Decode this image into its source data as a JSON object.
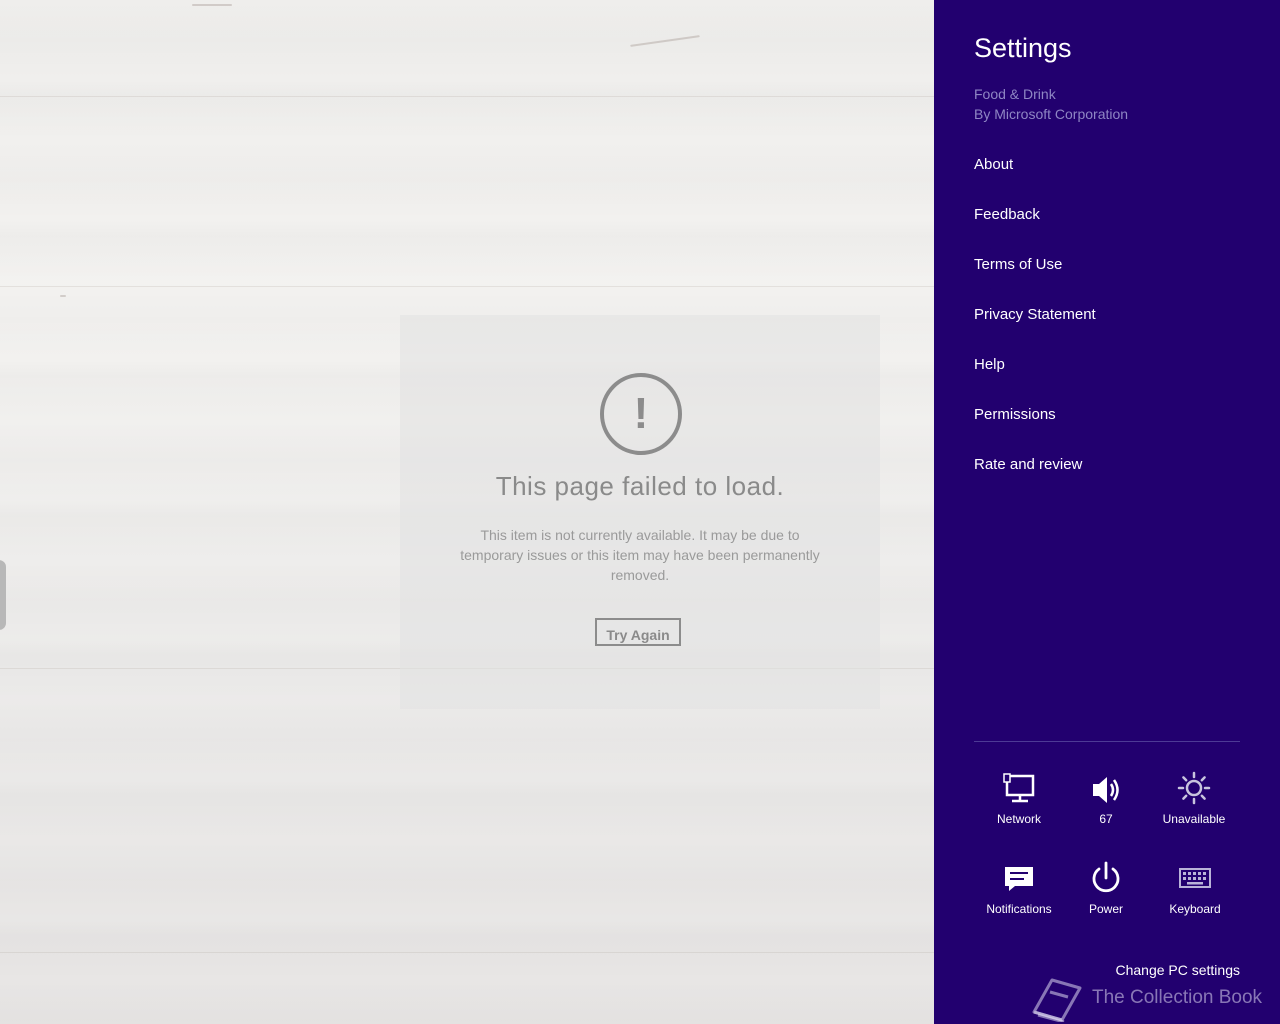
{
  "error": {
    "icon": "exclamation-circle-icon",
    "title": "This page failed to load.",
    "message": "This item is not currently available. It may be due to temporary issues or this item may have been permanently removed.",
    "button": "Try Again"
  },
  "settings": {
    "title": "Settings",
    "app_name": "Food & Drink",
    "app_publisher": "By Microsoft Corporation",
    "background_color": "#22006f",
    "menu": [
      {
        "label": "About"
      },
      {
        "label": "Feedback"
      },
      {
        "label": "Terms of Use"
      },
      {
        "label": "Privacy Statement"
      },
      {
        "label": "Help"
      },
      {
        "label": "Permissions"
      },
      {
        "label": "Rate and review"
      }
    ],
    "quick_actions": [
      {
        "icon": "network-icon",
        "label": "Network"
      },
      {
        "icon": "volume-icon",
        "label": "67"
      },
      {
        "icon": "brightness-icon",
        "label": "Unavailable"
      },
      {
        "icon": "notifications-icon",
        "label": "Notifications"
      },
      {
        "icon": "power-icon",
        "label": "Power"
      },
      {
        "icon": "keyboard-icon",
        "label": "Keyboard"
      }
    ],
    "change_pc_settings": "Change PC settings"
  },
  "watermark": {
    "icon": "book-icon",
    "text": "The Collection Book"
  }
}
